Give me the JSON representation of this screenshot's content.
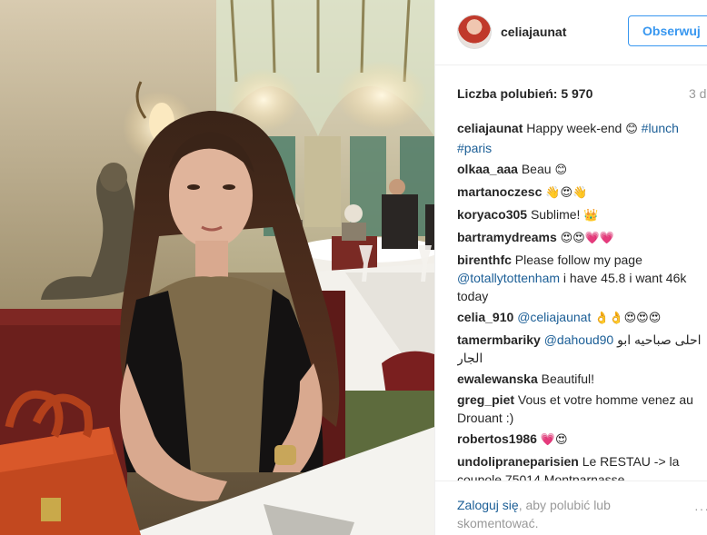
{
  "header": {
    "username": "celiajaunat",
    "follow_label": "Obserwuj"
  },
  "post": {
    "likes_text": "Liczba polubień: 5 970",
    "time_text": "3 d"
  },
  "comments": [
    {
      "author": "celiajaunat",
      "parts": [
        {
          "t": "text",
          "v": " Happy week-end "
        },
        {
          "t": "emoji",
          "v": "😊"
        },
        {
          "t": "text",
          "v": " "
        },
        {
          "t": "link",
          "v": "#lunch"
        },
        {
          "t": "text",
          "v": " "
        },
        {
          "t": "link",
          "v": "#paris"
        }
      ]
    },
    {
      "author": "olkaa_aaa",
      "parts": [
        {
          "t": "text",
          "v": " Beau "
        },
        {
          "t": "emoji",
          "v": "😊"
        }
      ]
    },
    {
      "author": "martanoczesc",
      "parts": [
        {
          "t": "text",
          "v": " "
        },
        {
          "t": "emoji",
          "v": "👋😍👋"
        }
      ]
    },
    {
      "author": "koryaco305",
      "parts": [
        {
          "t": "text",
          "v": " Sublime! "
        },
        {
          "t": "emoji",
          "v": "👑"
        }
      ]
    },
    {
      "author": "bartramydreams",
      "parts": [
        {
          "t": "text",
          "v": " "
        },
        {
          "t": "emoji",
          "v": "😍😍💗💗"
        }
      ]
    },
    {
      "author": "birenthfc",
      "parts": [
        {
          "t": "text",
          "v": " Please follow my page "
        },
        {
          "t": "link",
          "v": "@totallytottenham"
        },
        {
          "t": "text",
          "v": " i have 45.8 i want 46k today"
        }
      ]
    },
    {
      "author": "celia_910",
      "parts": [
        {
          "t": "text",
          "v": " "
        },
        {
          "t": "link",
          "v": "@celiajaunat"
        },
        {
          "t": "text",
          "v": " "
        },
        {
          "t": "emoji",
          "v": "👌👌😍😍😍"
        }
      ]
    },
    {
      "author": "tamermbariky",
      "parts": [
        {
          "t": "text",
          "v": " "
        },
        {
          "t": "link",
          "v": "@dahoud90"
        },
        {
          "t": "text",
          "v": " احلى صباحيه ابو الجار"
        }
      ]
    },
    {
      "author": "ewalewanska",
      "parts": [
        {
          "t": "text",
          "v": " Beautiful!"
        }
      ]
    },
    {
      "author": "greg_piet",
      "parts": [
        {
          "t": "text",
          "v": " Vous et votre homme venez au Drouant :)"
        }
      ]
    },
    {
      "author": "robertos1986",
      "parts": [
        {
          "t": "text",
          "v": " "
        },
        {
          "t": "emoji",
          "v": "💗😍"
        }
      ]
    },
    {
      "author": "undolipraneparisien",
      "parts": [
        {
          "t": "text",
          "v": " Le RESTAU -> la coupole 75014 Montparnasse"
        }
      ]
    }
  ],
  "footer": {
    "login_link": "Zaloguj się",
    "login_rest": ", aby polubić lub skomentować.",
    "more": "···"
  }
}
